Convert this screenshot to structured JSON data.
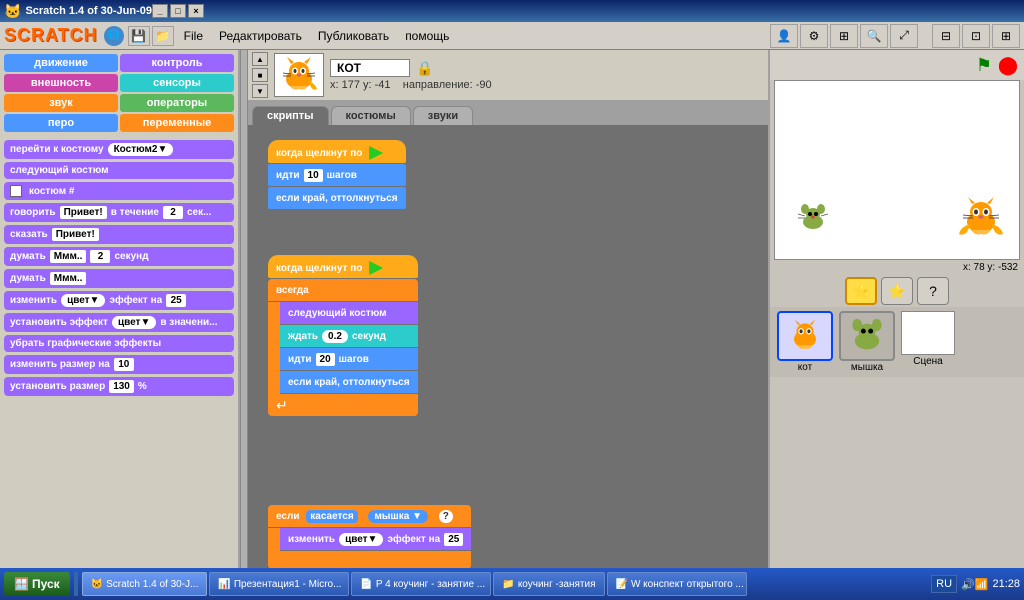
{
  "titlebar": {
    "title": "Scratch 1.4 of 30-Jun-09",
    "minimize": "_",
    "maximize": "□",
    "close": "×"
  },
  "menubar": {
    "file": "File",
    "edit": "Редактировать",
    "publish": "Публиковать",
    "help": "помощь"
  },
  "sprite": {
    "name": "КОТ",
    "x": "x: 177",
    "y": "y: -41",
    "direction": "направление: -90"
  },
  "tabs": {
    "scripts": "скрипты",
    "costumes": "костюмы",
    "sounds": "звуки"
  },
  "categories": [
    {
      "label": "движение",
      "color": "blue"
    },
    {
      "label": "контроль",
      "color": "purple"
    },
    {
      "label": "внешность",
      "color": "pink"
    },
    {
      "label": "сенсоры",
      "color": "teal"
    },
    {
      "label": "звук",
      "color": "orange"
    },
    {
      "label": "операторы",
      "color": "green"
    },
    {
      "label": "перо",
      "color": "blue"
    },
    {
      "label": "переменные",
      "color": "orange"
    }
  ],
  "blocks": [
    {
      "label": "перейти к костюму",
      "extra": "Костюм2",
      "color": "purple"
    },
    {
      "label": "следующий костюм",
      "color": "purple"
    },
    {
      "label": "костюм #",
      "color": "purple"
    },
    {
      "label": "говорить",
      "extra1": "Привет!",
      "extra2": "в течение",
      "num": "2",
      "suffix": "сек...",
      "color": "purple"
    },
    {
      "label": "сказать",
      "extra": "Привет!",
      "color": "purple"
    },
    {
      "label": "думать",
      "extra1": "Ммм..",
      "num": "2",
      "suffix": "секунд",
      "color": "purple"
    },
    {
      "label": "думать",
      "extra": "Ммм..",
      "color": "purple"
    },
    {
      "label": "изменить",
      "extra1": "цвет",
      "suffix": "эффект на",
      "num": "25",
      "color": "purple"
    },
    {
      "label": "установить эффект",
      "extra": "цвет",
      "suffix": "в значени...",
      "color": "purple"
    },
    {
      "label": "убрать графические эффекты",
      "color": "purple"
    },
    {
      "label": "изменить размер на",
      "num": "10",
      "color": "purple"
    },
    {
      "label": "установить размер",
      "num": "130",
      "suffix": "%",
      "color": "purple"
    }
  ],
  "scripts": [
    {
      "group": 1,
      "blocks": [
        {
          "type": "hat",
          "color": "yellow",
          "text": "когда щелкнут по",
          "flag": true
        },
        {
          "type": "normal",
          "color": "blue",
          "text": "идти",
          "num": "10",
          "suffix": "шагов"
        },
        {
          "type": "normal",
          "color": "blue",
          "text": "если край, оттолкнуться"
        }
      ]
    },
    {
      "group": 2,
      "blocks": [
        {
          "type": "hat",
          "color": "yellow",
          "text": "когда щелкнут по",
          "flag": true
        },
        {
          "type": "c-top",
          "color": "orange",
          "text": "всегда"
        },
        {
          "type": "c-inner",
          "color": "purple",
          "text": "следующий костюм"
        },
        {
          "type": "c-inner",
          "color": "teal",
          "text": "ждать",
          "num": "0.2",
          "suffix": "секунд"
        },
        {
          "type": "c-inner",
          "color": "blue",
          "text": "идти",
          "num": "20",
          "suffix": "шагов"
        },
        {
          "type": "c-inner",
          "color": "blue",
          "text": "если край, оттолкнуться"
        },
        {
          "type": "c-bottom",
          "color": "orange",
          "arrow": "↵"
        }
      ]
    },
    {
      "group": 3,
      "blocks": [
        {
          "type": "c-top",
          "color": "orange",
          "text": "если",
          "condition": "касается",
          "pill": "мышка",
          "q": "?"
        },
        {
          "type": "c-inner",
          "color": "purple",
          "text": "изменить",
          "extra": "цвет",
          "suffix": "эффект на",
          "num": "25"
        },
        {
          "type": "c-bottom",
          "color": "orange"
        }
      ]
    }
  ],
  "stage": {
    "coords": "x: 78   y: -532"
  },
  "sprites": [
    {
      "name": "кот",
      "selected": true
    },
    {
      "name": "мышка",
      "selected": false
    }
  ],
  "scene_label": "Сцена",
  "taskbar": {
    "start": "Пуск",
    "items": [
      {
        "label": "Scratch 1.4 of 30-J...",
        "active": true
      },
      {
        "label": "Презентация1 - Micro...",
        "active": false
      },
      {
        "label": "P 4 коучинг - занятие ...",
        "active": false
      },
      {
        "label": "коучинг -занятия",
        "active": false
      },
      {
        "label": "W конспект открытого ...",
        "active": false
      }
    ],
    "lang": "RU",
    "time": "21:28"
  }
}
